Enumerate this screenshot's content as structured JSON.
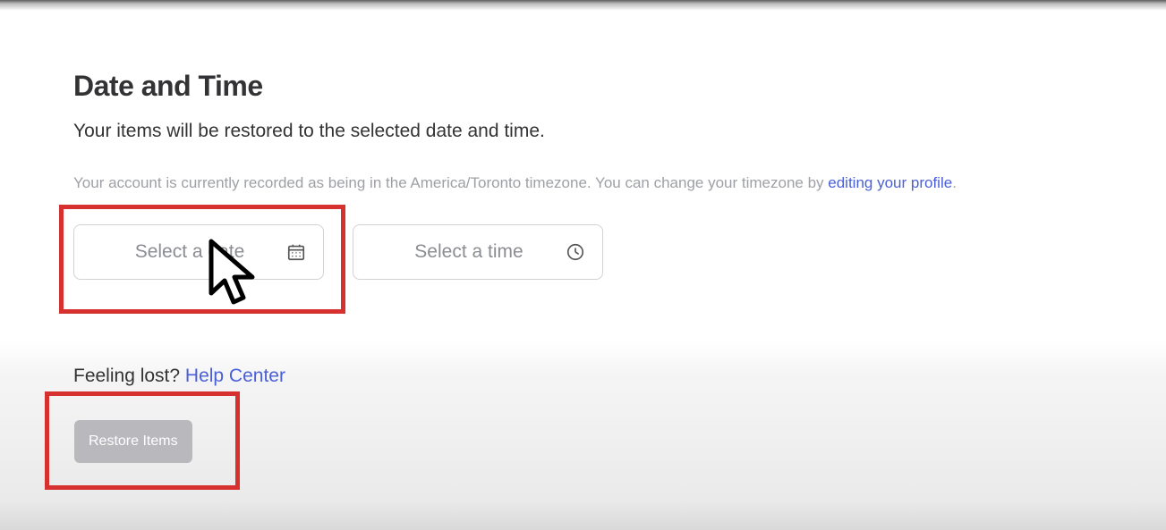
{
  "header": {
    "title": "Date and Time",
    "subtitle": "Your items will be restored to the selected date and time."
  },
  "timezone": {
    "prefix": "Your account is currently recorded as being in the America/Toronto timezone. You can change your timezone by ",
    "link_label": "editing your profile",
    "suffix": "."
  },
  "pickers": {
    "date_placeholder": "Select a date",
    "time_placeholder": "Select a time",
    "date_value": "",
    "time_value": ""
  },
  "help": {
    "prefix": "Feeling lost? ",
    "link_label": "Help Center"
  },
  "actions": {
    "restore_label": "Restore Items"
  }
}
